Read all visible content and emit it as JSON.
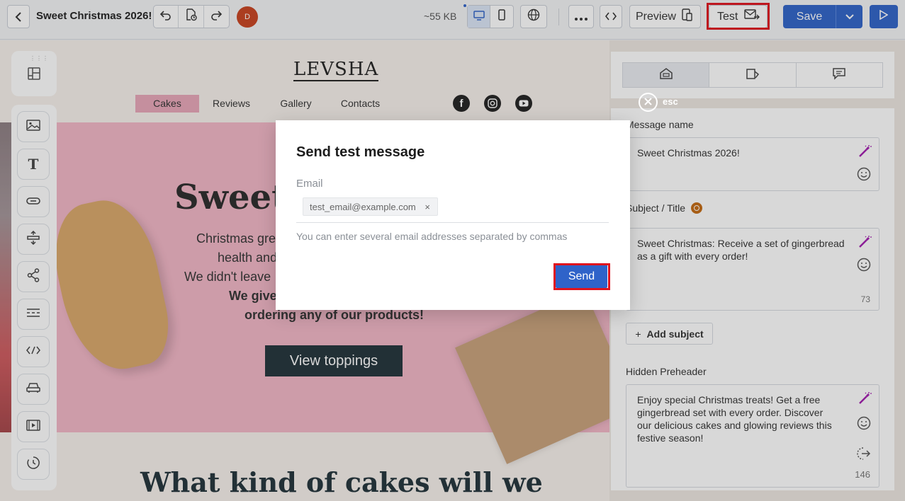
{
  "toolbar": {
    "title": "Sweet Christmas 2026!",
    "avatar_letter": "D",
    "size": "~55 KB",
    "preview_label": "Preview",
    "test_label": "Test",
    "save_label": "Save"
  },
  "email": {
    "logo": "LEVSHA",
    "nav": [
      "Cakes",
      "Reviews",
      "Gallery",
      "Contacts"
    ],
    "hero_title": "Sweet",
    "hero_lines": [
      "Christmas gre",
      "health and",
      "We didn't leave",
      "We give",
      "ordering any of our products!"
    ],
    "cta": "View toppings",
    "section_heading": "What kind of cakes will we"
  },
  "settings_panel": {
    "esc_label": "esc",
    "message_name_label": "Message name",
    "message_name_value": "Sweet Christmas 2026!",
    "subject_label": "Subject / Title",
    "subject_value": "Sweet Christmas: Receive a set of gingerbread as a gift with every order!",
    "subject_count": "73",
    "add_subject_label": "Add subject",
    "preheader_label": "Hidden Preheader",
    "preheader_value": "Enjoy special Christmas treats! Get a free gingerbread set with every order. Discover our delicious cakes and glowing reviews this festive season!",
    "preheader_count": "146"
  },
  "modal": {
    "title": "Send test message",
    "email_label": "Email",
    "email_chip": "test_email@example.com",
    "hint": "You can enter several email addresses separated by commas",
    "send_label": "Send"
  },
  "colors": {
    "primary": "#2f63c9",
    "highlight": "#e0141e",
    "hero_pink": "#f2b6c6",
    "nav_active": "#e8a7b9",
    "dark_button": "#22323a"
  }
}
